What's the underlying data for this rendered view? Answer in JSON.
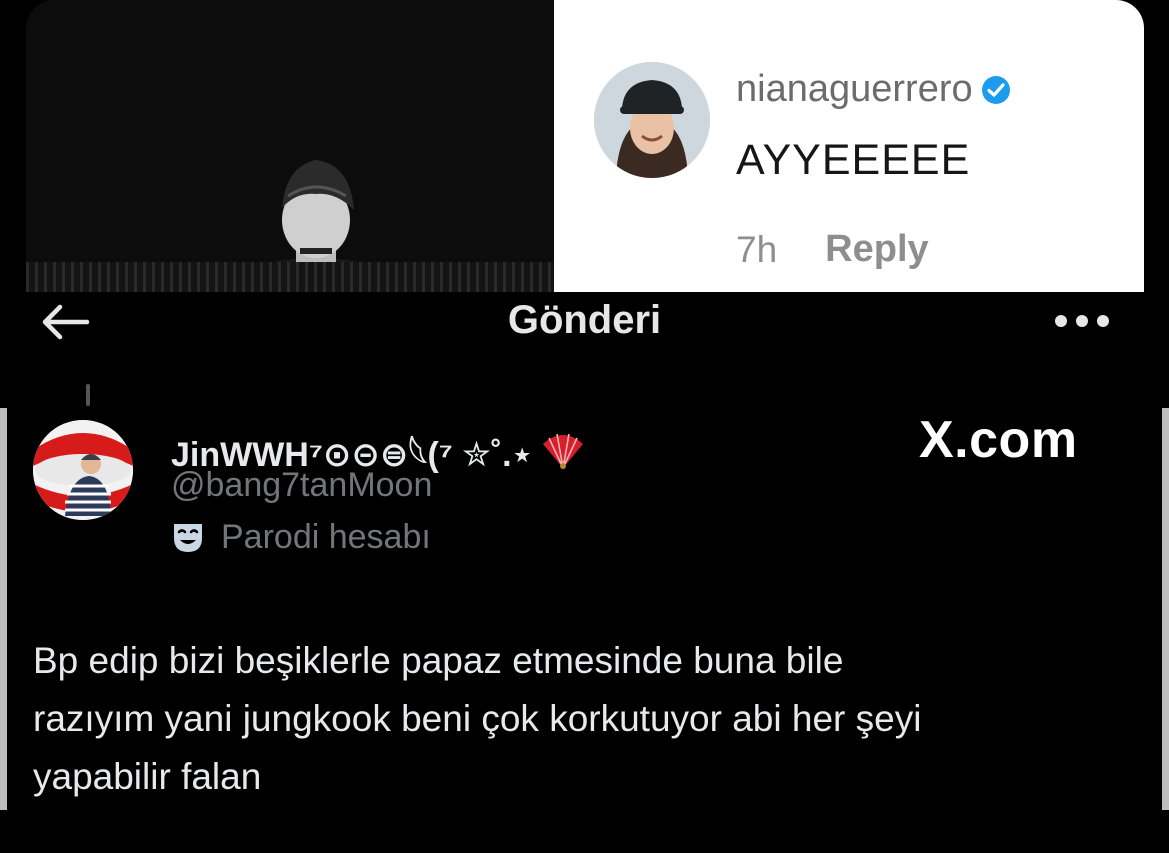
{
  "comment": {
    "username": "nianaguerrero",
    "text": "AYYEEEEE",
    "time": "7h",
    "reply_label": "Reply"
  },
  "header": {
    "title": "Gönderi",
    "back_icon": "arrow-left-icon",
    "more_icon": "more-horizontal-icon"
  },
  "tweet": {
    "display_name": "JinWWH⁷⊙⊝⊜𓆩(⁷ ✮˚.⋆",
    "handle": "@bang7tanMoon",
    "label_icon": "theater-mask-icon",
    "label": "Parodi hesabı",
    "watermark": "X.com",
    "body_lines": [
      "Bp edip bizi beşiklerle papaz etmesinde buna bile",
      "razıyım yani jungkook beni çok korkutuyor abi her şeyi",
      "yapabilir falan"
    ]
  },
  "colors": {
    "background": "#000000",
    "verified": "#1d9bf0",
    "secondary_text": "#71767b",
    "primary_text": "#e7e9ea"
  }
}
